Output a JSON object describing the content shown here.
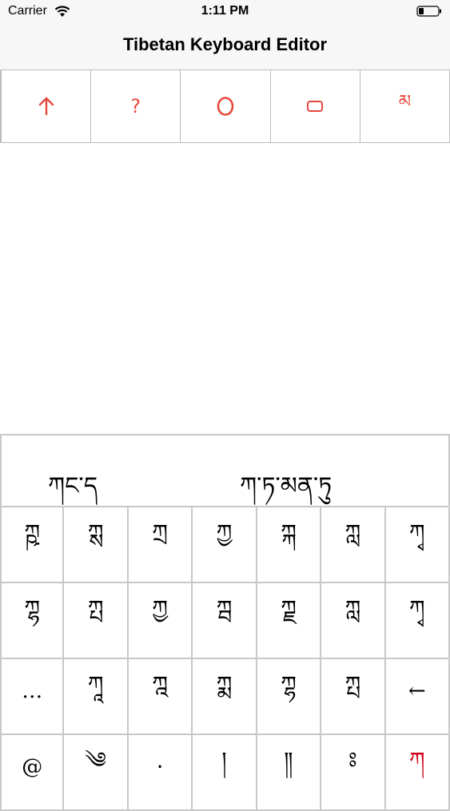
{
  "status_bar": {
    "carrier": "Carrier",
    "time": "1:11 PM"
  },
  "nav": {
    "title": "Tibetan Keyboard Editor"
  },
  "toolbar": {
    "accent": "#e5483d",
    "buttons": [
      {
        "icon": "arrow-up-icon",
        "label": ""
      },
      {
        "icon": "question-icon",
        "label": "?"
      },
      {
        "icon": "circle-o-icon",
        "label": ""
      },
      {
        "icon": "rounded-rect-icon",
        "label": ""
      },
      {
        "icon": "tibetan-ma-icon",
        "label": "མ"
      }
    ]
  },
  "keyboard": {
    "suggestions": [
      "ཀང་ད",
      "ཀ་ཏ་མན་ཏུ"
    ],
    "rows": [
      [
        "ཀྵ",
        "ཀྶ",
        "ཀྲ",
        "ཀྱ",
        "ཀྐ",
        "ཀླ",
        "ཀྭ"
      ],
      [
        "ཀྷ",
        "ཀྤ",
        "ཀྱ",
        "ཀྦ",
        "ཀྗ",
        "ཀླ",
        "ཀྭ"
      ],
      [
        "…",
        "ཀཱ",
        "ཀྰ",
        "ཀྨ",
        "ཀྷ",
        "ཀྤ",
        "←"
      ],
      [
        "@",
        "༄",
        "·",
        "།",
        "༎",
        "ཿ",
        "ཀ"
      ]
    ],
    "highlight_color": "#d0021b"
  }
}
